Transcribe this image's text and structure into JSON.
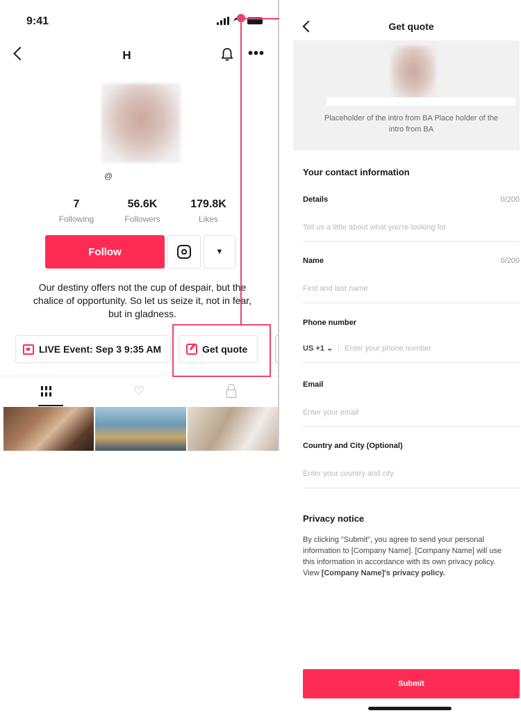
{
  "profile_screen": {
    "status": {
      "time": "9:41"
    },
    "header": {
      "title": "H"
    },
    "handle": "@",
    "stats": [
      {
        "value": "7",
        "label": "Following"
      },
      {
        "value": "56.6K",
        "label": "Followers"
      },
      {
        "value": "179.8K",
        "label": "Likes"
      }
    ],
    "follow_label": "Follow",
    "bio": "Our destiny offers not the cup of despair, but the chalice of opportunity. So let us seize it, not in fear, but in gladness.",
    "chips": {
      "live_event": "LIVE Event: Sep 3 9:35 AM",
      "get_quote": "Get quote"
    },
    "icons": [
      "back-icon",
      "bell-icon",
      "more-icon",
      "instagram-icon",
      "chevron-down-icon",
      "calendar-icon",
      "edit-icon",
      "grid-icon",
      "liked-icon",
      "lock-icon"
    ],
    "accent_color": "#fe2c55",
    "annotation_color": "#e8456b"
  },
  "quote_screen": {
    "header": {
      "title": "Get quote"
    },
    "intro": "Placeholder of the intro from BA Place holder of the intro from BA",
    "contact_heading": "Your contact information",
    "fields": {
      "details": {
        "label": "Details",
        "count": "0/200",
        "placeholder": "Tell us a little about what you're looking for"
      },
      "name": {
        "label": "Name",
        "count": "0/200",
        "placeholder": "First and last name"
      },
      "phone": {
        "label": "Phone number",
        "country_code": "US +1",
        "placeholder": "Enter your phone number"
      },
      "email": {
        "label": "Email",
        "placeholder": "Enter your email"
      },
      "location": {
        "label": "Country and City (Optional)",
        "placeholder": "Enter your country and city"
      }
    },
    "privacy": {
      "heading": "Privacy notice",
      "text": "By clicking \"Submit\", you agree to send your personal information to [Company Name]. [Company Name] will use this information in accordance with its own privacy policy. View ",
      "link": "[Company Name]'s privacy policy."
    },
    "submit_label": "Submit"
  }
}
